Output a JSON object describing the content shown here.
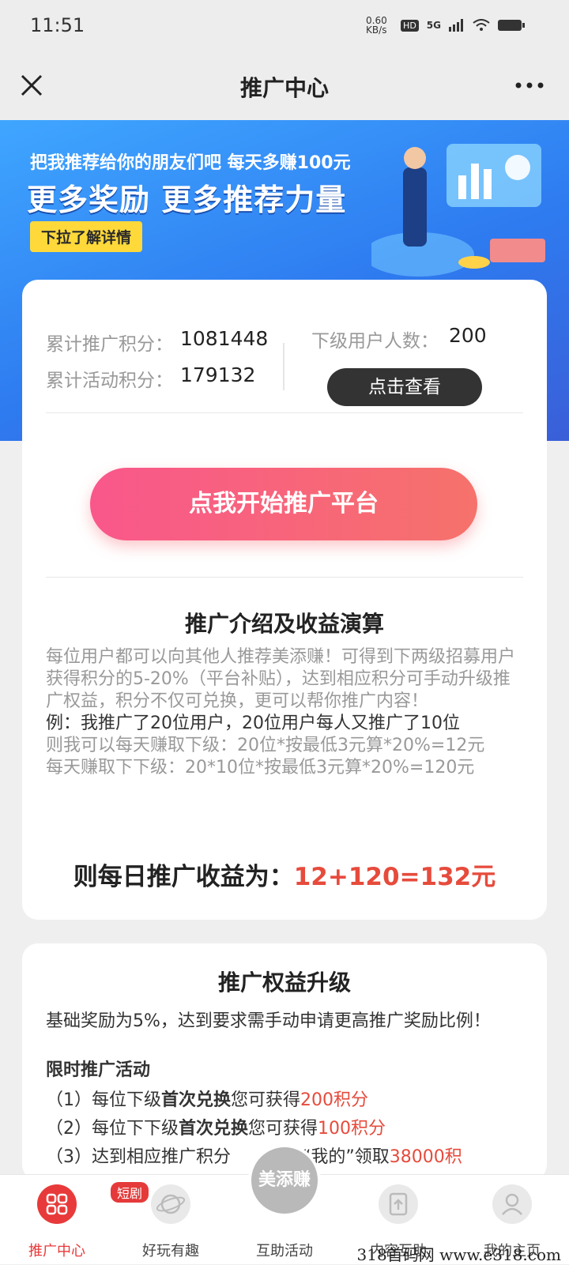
{
  "status": {
    "time": "11:51",
    "net_speed": "0.60 KB/s",
    "network": "5G"
  },
  "nav": {
    "title": "推广中心"
  },
  "banner": {
    "line1": "把我推荐给你的朋友们吧 每天多赚100元",
    "line2": "更多奖励 更多推荐力量",
    "pill": "下拉了解详情"
  },
  "stats": {
    "total_promo_label": "累计推广积分：",
    "total_promo_value": "1081448",
    "total_activity_label": "累计活动积分：",
    "total_activity_value": "179132",
    "sub_users_label": "下级用户人数：",
    "sub_users_value": "200",
    "view_button": "点击查看"
  },
  "cta": {
    "label": "点我开始推广平台"
  },
  "intro": {
    "title": "推广介绍及收益演算",
    "para1": "每位用户都可以向其他人推荐美添赚！可得到下两级招募用户获得积分的5-20%（平台补贴），达到相应积分可手动升级推广权益，积分不仅可兑换，更可以帮你推广内容！",
    "example": "例：我推广了20位用户，20位用户每人又推广了10位",
    "calc1": "则我可以每天赚取下级：20位*按最低3元算*20%=12元",
    "calc2": "每天赚取下下级：20*10位*按最低3元算*20%=120元",
    "income_label": "则每日推广收益为：",
    "income_value": "12+120=132元"
  },
  "upgrade": {
    "title": "推广权益升级",
    "base": "基础奖励为5%，达到要求需手动申请更高推广奖励比例！",
    "activity_title": "限时推广活动",
    "item1_pre": "（1）每位下级",
    "item1_bold": "首次兑换",
    "item1_mid": "您可获得",
    "item1_red": "200积分",
    "item2_pre": "（2）每位下下级",
    "item2_bold": "首次兑换",
    "item2_mid": "您可获得",
    "item2_red": "100积分",
    "item3_pre": "（3）达到相应推广积分",
    "item3_mid": "“我的”领取",
    "item3_red": "38000积"
  },
  "tabbar": {
    "tabs": [
      {
        "label": "推广中心",
        "icon": "grid-icon",
        "active": true
      },
      {
        "label": "好玩有趣",
        "icon": "planet-icon"
      },
      {
        "label": "互助活动",
        "icon": "logo-icon"
      },
      {
        "label": "内容互助",
        "icon": "upload-icon"
      },
      {
        "label": "我的主页",
        "icon": "user-icon"
      }
    ],
    "short_badge": "短剧",
    "center_logo": "美添赚"
  },
  "watermark": "318首码网 www.e318.com"
}
